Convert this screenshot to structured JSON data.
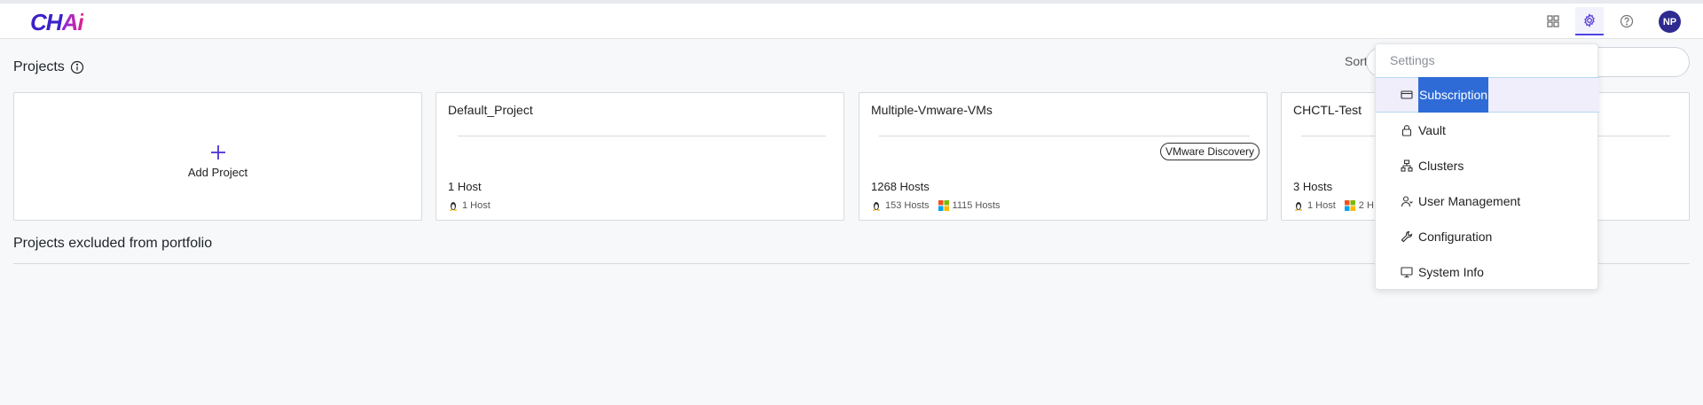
{
  "app": {
    "logo_main": "CH",
    "logo_accent": "Ai"
  },
  "header": {
    "avatar_initials": "NP",
    "icons": [
      "grid-icon",
      "gear-icon",
      "help-icon"
    ]
  },
  "projects": {
    "title": "Projects",
    "sort_label": "Sorte",
    "add_project_label": "Add Project",
    "cards": [
      {
        "name": "Default_Project",
        "hosts": "1 Host",
        "linux_hosts": "1 Host",
        "windows_hosts": "",
        "badge": ""
      },
      {
        "name": "Multiple-Vmware-VMs",
        "hosts": "1268 Hosts",
        "linux_hosts": "153 Hosts",
        "windows_hosts": "1115 Hosts",
        "badge": "VMware Discovery"
      },
      {
        "name": "CHCTL-Test",
        "hosts": "3 Hosts",
        "linux_hosts": "1 Host",
        "windows_hosts": "2 H",
        "badge": ""
      }
    ]
  },
  "excluded": {
    "title": "Projects excluded from portfolio"
  },
  "settings_menu": {
    "header": "Settings",
    "items": [
      {
        "label": "Subscription",
        "icon": "credit-card-icon",
        "selected": true
      },
      {
        "label": "Vault",
        "icon": "lock-icon"
      },
      {
        "label": "Clusters",
        "icon": "clusters-icon"
      },
      {
        "label": "User Management",
        "icon": "user-management-icon"
      },
      {
        "label": "Configuration",
        "icon": "wrench-icon"
      },
      {
        "label": "System Info",
        "icon": "monitor-icon"
      }
    ]
  },
  "colors": {
    "brand": "#3b22c9",
    "accent": "#4f46e5",
    "selection": "#2e6bd6",
    "avatar": "#2e2a8f"
  }
}
